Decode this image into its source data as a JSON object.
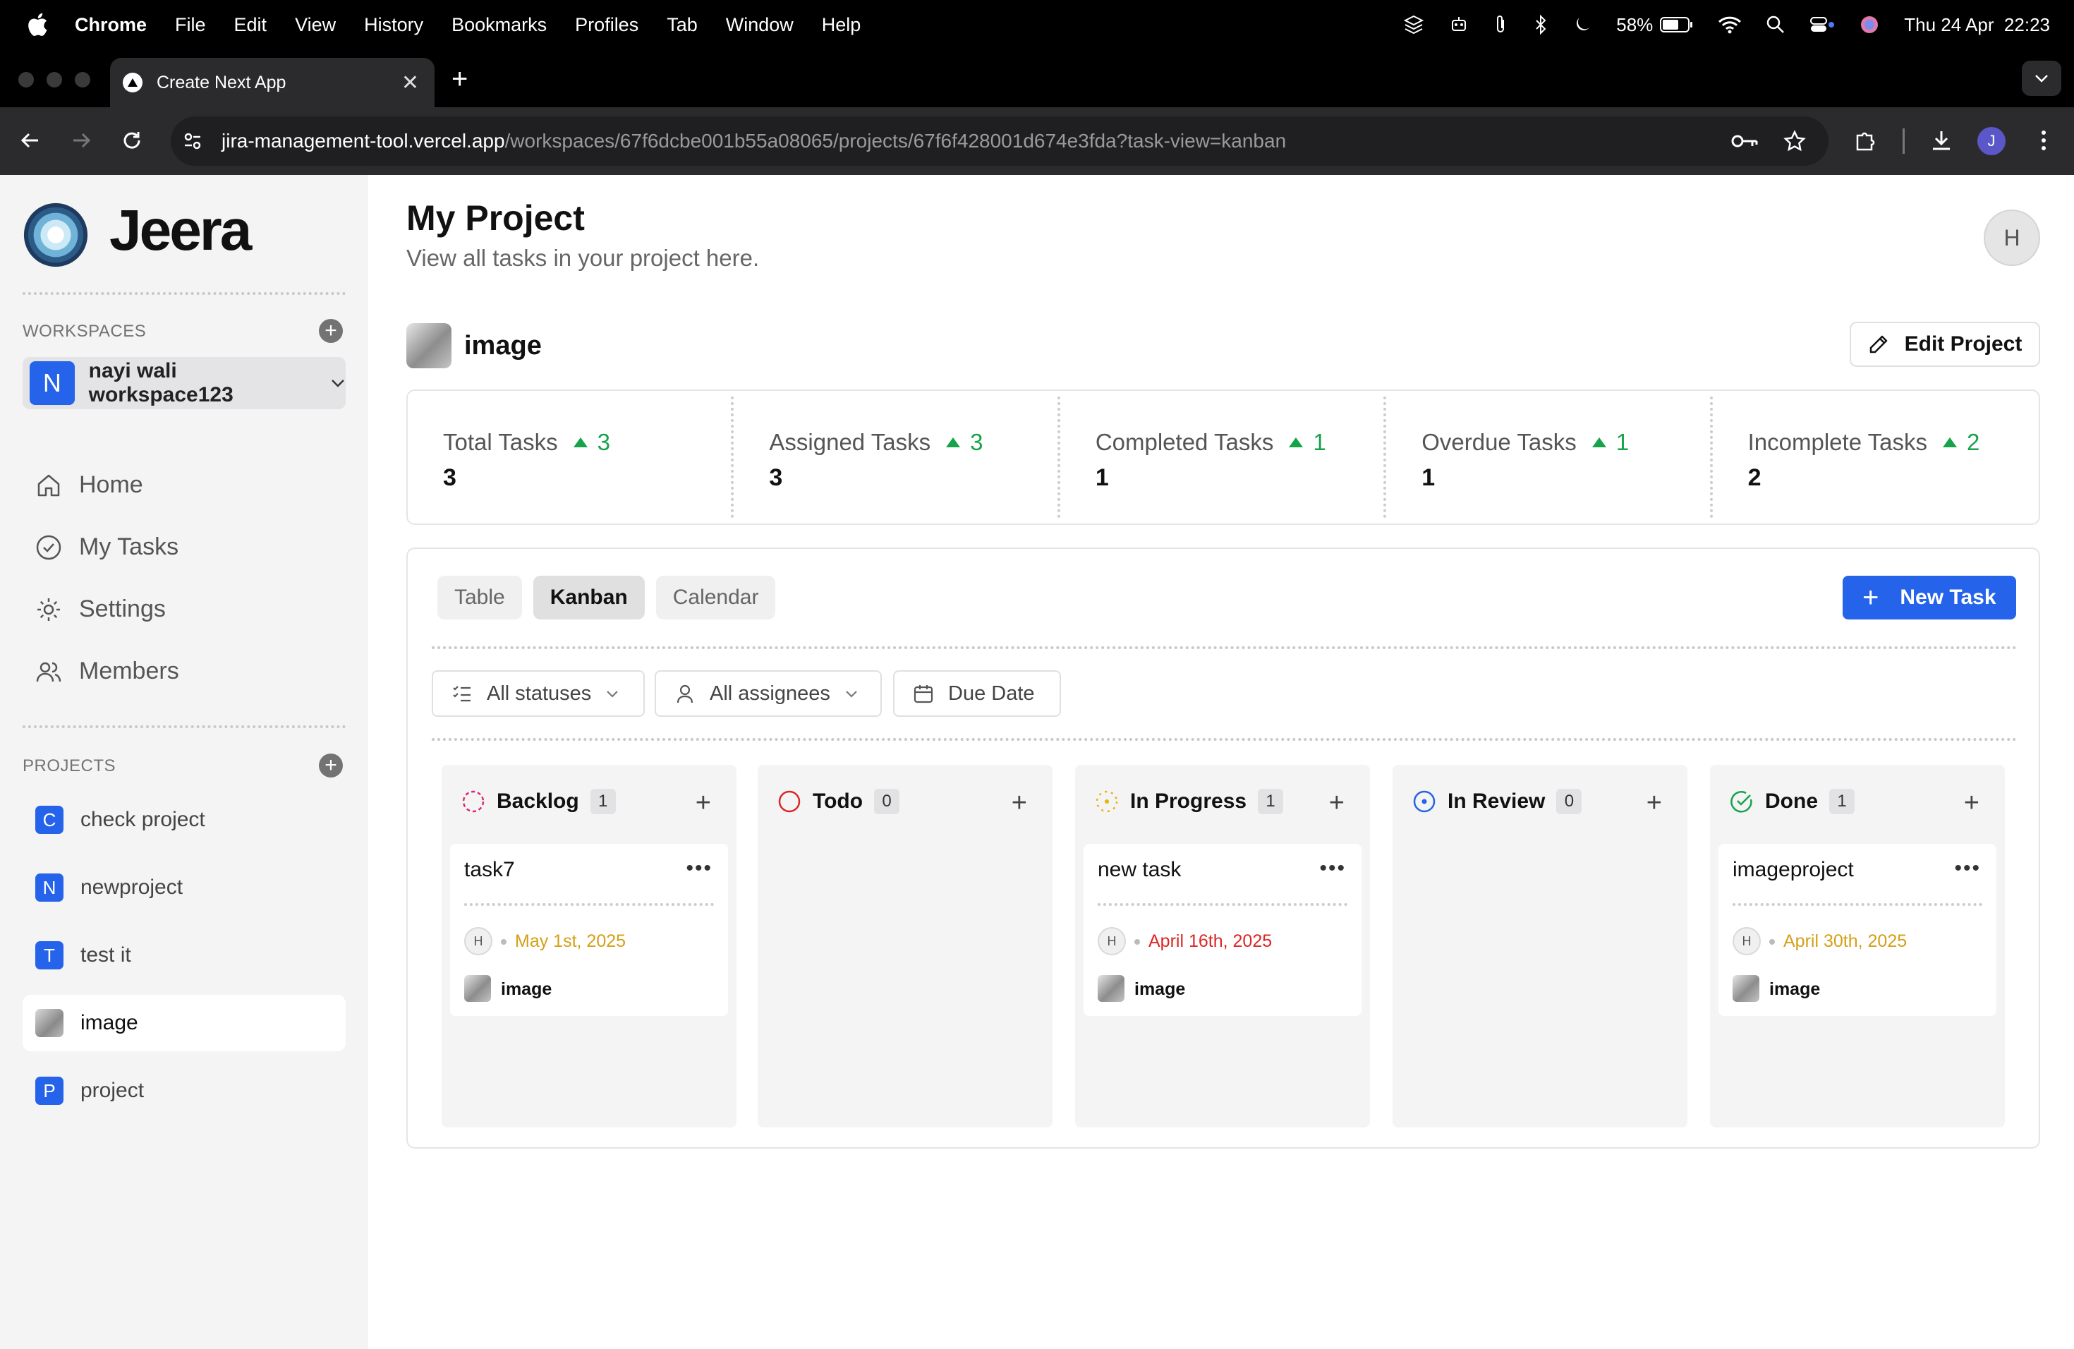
{
  "os_menubar": {
    "app": "Chrome",
    "items": [
      "File",
      "Edit",
      "View",
      "History",
      "Bookmarks",
      "Profiles",
      "Tab",
      "Window",
      "Help"
    ],
    "battery": "58%",
    "datetime": "Thu 24 Apr  22:23"
  },
  "browser": {
    "tab_title": "Create Next App",
    "url_site": "jira-management-tool.vercel.app",
    "url_path": "/workspaces/67f6dcbe001b55a08065/projects/67f6f428001d674e3fda?task-view=kanban",
    "profile_initial": "J"
  },
  "sidebar": {
    "brand": "Jeera",
    "workspaces_label": "WORKSPACES",
    "workspace": {
      "initial": "N",
      "name": "nayi wali workspace123"
    },
    "nav": [
      {
        "label": "Home",
        "icon": "home-icon"
      },
      {
        "label": "My Tasks",
        "icon": "check-circle-icon"
      },
      {
        "label": "Settings",
        "icon": "gear-icon"
      },
      {
        "label": "Members",
        "icon": "users-icon"
      }
    ],
    "projects_label": "PROJECTS",
    "projects": [
      {
        "initial": "C",
        "name": "check project"
      },
      {
        "initial": "N",
        "name": "newproject"
      },
      {
        "initial": "T",
        "name": "test it"
      },
      {
        "initial": "",
        "name": "image",
        "active": true
      },
      {
        "initial": "P",
        "name": "project"
      }
    ]
  },
  "header": {
    "title": "My Project",
    "subtitle": "View all tasks in your project here.",
    "user_initial": "H"
  },
  "project": {
    "name": "image",
    "edit_label": "Edit Project"
  },
  "stats": [
    {
      "label": "Total Tasks",
      "delta": "3",
      "value": "3"
    },
    {
      "label": "Assigned Tasks",
      "delta": "3",
      "value": "3"
    },
    {
      "label": "Completed Tasks",
      "delta": "1",
      "value": "1"
    },
    {
      "label": "Overdue Tasks",
      "delta": "1",
      "value": "1"
    },
    {
      "label": "Incomplete Tasks",
      "delta": "2",
      "value": "2"
    }
  ],
  "views": {
    "tabs": [
      "Table",
      "Kanban",
      "Calendar"
    ],
    "active": "Kanban",
    "new_task_label": "New Task"
  },
  "filters": {
    "status": "All statuses",
    "assignee": "All assignees",
    "due": "Due Date"
  },
  "columns": [
    {
      "title": "Backlog",
      "count": "1",
      "color": "#db2777",
      "icon": "dashed-circle-icon",
      "cards": [
        {
          "title": "task7",
          "assignee": "H",
          "due": "May 1st, 2025",
          "due_color": "#d4a017",
          "project": "image"
        }
      ]
    },
    {
      "title": "Todo",
      "count": "0",
      "color": "#dc2626",
      "icon": "circle-icon",
      "cards": []
    },
    {
      "title": "In Progress",
      "count": "1",
      "color": "#eab308",
      "icon": "dotted-circle-icon",
      "cards": [
        {
          "title": "new task",
          "assignee": "H",
          "due": "April 16th, 2025",
          "due_color": "#dc2626",
          "project": "image"
        }
      ]
    },
    {
      "title": "In Review",
      "count": "0",
      "color": "#2563eb",
      "icon": "dot-circle-icon",
      "cards": []
    },
    {
      "title": "Done",
      "count": "1",
      "color": "#16a34a",
      "icon": "check-circle-icon",
      "cards": [
        {
          "title": "imageproject",
          "assignee": "H",
          "due": "April 30th, 2025",
          "due_color": "#d4a017",
          "project": "image"
        }
      ]
    }
  ]
}
